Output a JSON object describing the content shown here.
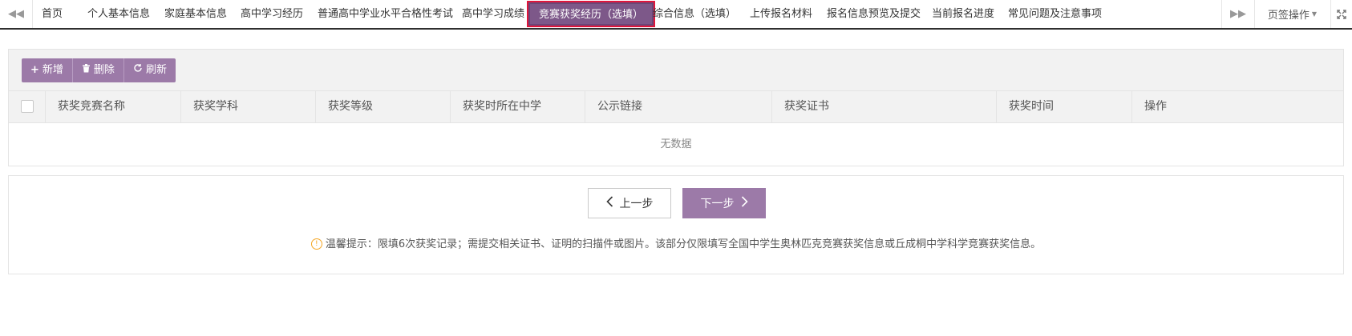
{
  "tabbar": {
    "tabs": [
      {
        "label": "首页"
      },
      {
        "label": "个人基本信息"
      },
      {
        "label": "家庭基本信息"
      },
      {
        "label": "高中学习经历"
      },
      {
        "label": "普通高中学业水平合格性考试"
      },
      {
        "label": "高中学习成绩"
      },
      {
        "label": "竞赛获奖经历（选填）",
        "active": true
      },
      {
        "label": "综合信息（选填）"
      },
      {
        "label": "上传报名材料"
      },
      {
        "label": "报名信息预览及提交"
      },
      {
        "label": "当前报名进度"
      },
      {
        "label": "常见问题及注意事项"
      }
    ],
    "page_ops_label": "页签操作",
    "icons": {
      "scroll_left": "double-chevron-left-icon",
      "scroll_right": "double-chevron-right-icon",
      "fullscreen": "fullscreen-icon"
    }
  },
  "toolbar": {
    "add_label": "新增",
    "delete_label": "删除",
    "refresh_label": "刷新"
  },
  "table": {
    "columns": [
      "获奖竞赛名称",
      "获奖学科",
      "获奖等级",
      "获奖时所在中学",
      "公示链接",
      "获奖证书",
      "获奖时间",
      "操作"
    ],
    "empty_text": "无数据"
  },
  "steps": {
    "prev_label": "上一步",
    "next_label": "下一步"
  },
  "tip": "温馨提示：限填6次获奖记录；需提交相关证书、证明的扫描件或图片。该部分仅限填写全国中学生奥林匹克竞赛获奖信息或丘成桐中学科学竞赛获奖信息。",
  "colors": {
    "accent": "#9c7aa8",
    "active_tab_bg": "#7d5889",
    "active_tab_border": "#e0163b",
    "tip_icon": "#f5a623"
  }
}
